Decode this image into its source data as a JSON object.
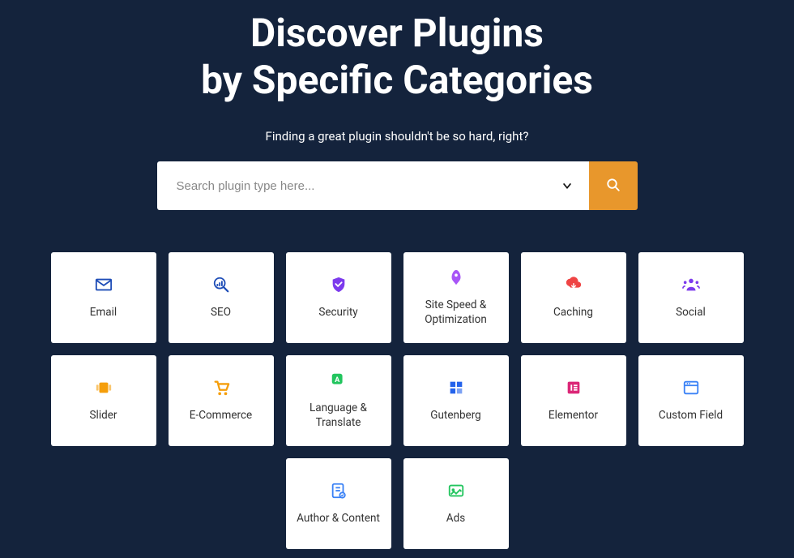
{
  "hero": {
    "title_line1": "Discover Plugins",
    "title_line2": "by Specific Categories",
    "subtitle": "Finding a great plugin shouldn't be so hard, right?"
  },
  "search": {
    "placeholder": "Search plugin type here..."
  },
  "categories": [
    {
      "label": "Email",
      "icon": "email",
      "color": "#1e4db7"
    },
    {
      "label": "SEO",
      "icon": "seo",
      "color": "#1e4db7"
    },
    {
      "label": "Security",
      "icon": "security",
      "color": "#7c3aed"
    },
    {
      "label": "Site Speed & Optimization",
      "icon": "rocket",
      "color": "#a855f7"
    },
    {
      "label": "Caching",
      "icon": "caching",
      "color": "#ef4444"
    },
    {
      "label": "Social",
      "icon": "social",
      "color": "#7c3aed"
    },
    {
      "label": "Slider",
      "icon": "slider",
      "color": "#f59e0b"
    },
    {
      "label": "E-Commerce",
      "icon": "cart",
      "color": "#f59e0b"
    },
    {
      "label": "Language & Translate",
      "icon": "translate",
      "color": "#22c55e"
    },
    {
      "label": "Gutenberg",
      "icon": "gutenberg",
      "color": "#2563eb"
    },
    {
      "label": "Elementor",
      "icon": "elementor",
      "color": "#db2777"
    },
    {
      "label": "Custom Field",
      "icon": "window",
      "color": "#3b82f6"
    },
    {
      "label": "Author & Content",
      "icon": "author",
      "color": "#3b82f6"
    },
    {
      "label": "Ads",
      "icon": "ads",
      "color": "#22c55e"
    }
  ]
}
